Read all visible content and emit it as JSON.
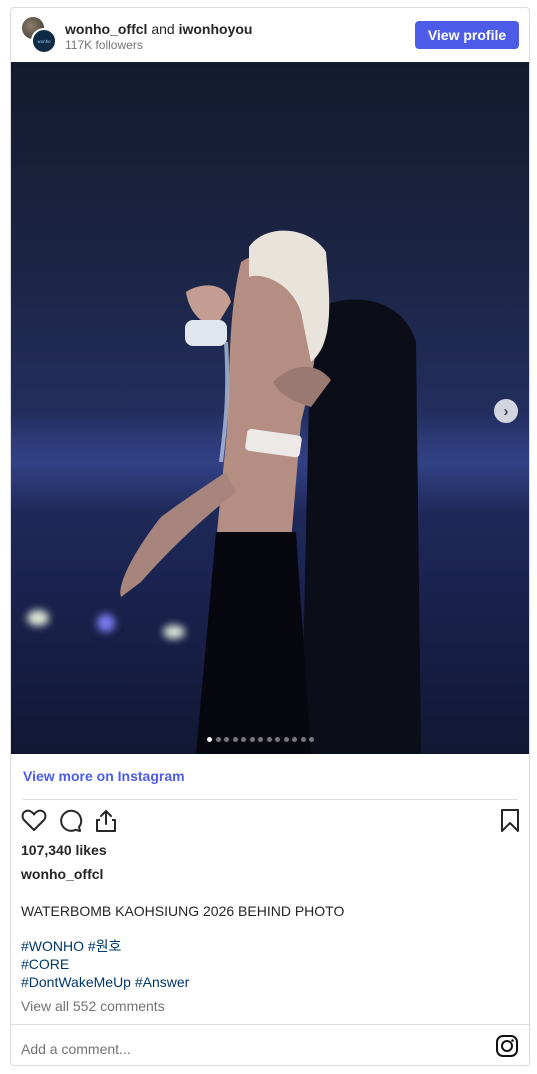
{
  "header": {
    "user1": "wonho_offcl",
    "joiner": "and",
    "user2": "iwonhoyou",
    "followers": "117K followers",
    "view_profile_label": "View profile"
  },
  "photo": {
    "current_slide": 1,
    "total_slides": 13
  },
  "view_more_label": "View more on Instagram",
  "likes": "107,340 likes",
  "author": "wonho_offcl",
  "caption": "WATERBOMB KAOHSIUNG 2026 BEHIND PHOTO",
  "hashtags": [
    "#WONHO #원호",
    "#CORE",
    "#DontWakeMeUp #Answer"
  ],
  "view_comments": "View all 552 comments",
  "comment_placeholder": "Add a comment...",
  "colors": {
    "accent": "#4c5ce9",
    "hashtag": "#00376b"
  },
  "icons": [
    "heart-icon",
    "comment-icon",
    "share-icon",
    "bookmark-icon",
    "instagram-icon",
    "chevron-right-icon"
  ]
}
